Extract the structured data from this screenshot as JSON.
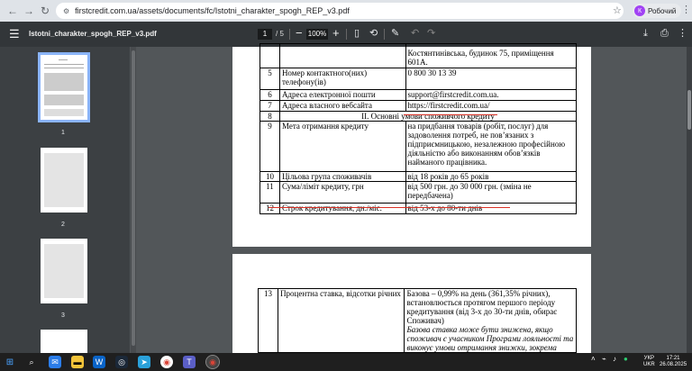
{
  "browser": {
    "url": "firstcredit.com.ua/assets/documents/fc/Istotni_charakter_spogh_REP_v3.pdf",
    "profile_label": "Робочий",
    "profile_initial": "К"
  },
  "pdf_toolbar": {
    "file_name": "Istotni_charakter_spogh_REP_v3.pdf",
    "current_page": "1",
    "total_pages": "/ 5",
    "zoom": "100%"
  },
  "thumbnails": [
    {
      "label": "1",
      "selected": true
    },
    {
      "label": "2",
      "selected": false
    },
    {
      "label": "3",
      "selected": false
    }
  ],
  "page1_rows": [
    {
      "n": "",
      "a": "",
      "b": "Костянтинівська, будинок 75, приміщення 601А."
    },
    {
      "n": "5",
      "a": "Номер контактного(них) телефону(ів)",
      "b": "0 800 30 13 39"
    },
    {
      "n": "6",
      "a": "Адреса електронної пошти",
      "b": "support@firstcredit.com.ua."
    },
    {
      "n": "7",
      "a": "Адреса власного вебсайта",
      "b": "https://firstcredit.com.ua/"
    },
    {
      "n": "8",
      "a": "II. Основні умови споживчого кредиту",
      "b": ""
    },
    {
      "n": "9",
      "a": "Мета отримання кредиту",
      "b": "на придбання товарів (робіт, послуг) для задоволення потреб, не пов’язаних з підприємницькою, незалежною професійною діяльністю або виконанням обов’язків найманого працівника."
    },
    {
      "n": "10",
      "a": "Цільова група споживачів",
      "b": "від 18 років до 65 років"
    },
    {
      "n": "11",
      "a": "Сума/ліміт кредиту, грн",
      "b": "від 500 грн. до 30 000 грн. (зміна не передбачена)"
    },
    {
      "n": "12",
      "a": "Строк кредитування, дн./міс.",
      "b": "від 53-х до 80-ти днів"
    }
  ],
  "page2_row": {
    "n": "13",
    "a": "Процентна ставка, відсотки річних",
    "b": "Базова – 0,99% на день (361,35% річних), встановлюється протягом першого періоду кредитування (від 3-х до 30-ти днів, обирає Споживач)",
    "b_italic": "Базова ставка може бути знижена, якщо споживач є учасником Програми лояльності та виконує умови отримання знижки, зокрема"
  },
  "taskbar": {
    "lang": "УКР",
    "lang2": "UKR",
    "time": "17:21",
    "date": "26.08.2025"
  }
}
